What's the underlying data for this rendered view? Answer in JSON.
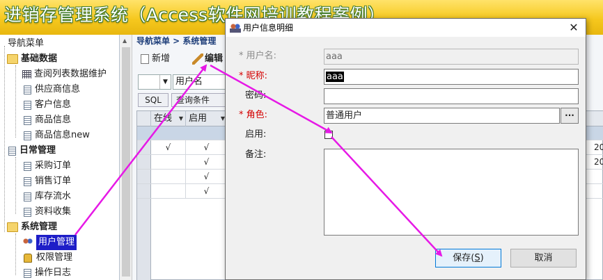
{
  "app": {
    "title": "进销存管理系统（Access软件网培训教程案例）"
  },
  "sidebar": {
    "root": "导航菜单",
    "groups": [
      {
        "label": "基础数据",
        "items": [
          "查阅列表数据维护",
          "供应商信息",
          "客户信息",
          "商品信息",
          "商品信息new"
        ]
      },
      {
        "label": "日常管理",
        "items": [
          "采购订单",
          "销售订单",
          "库存流水",
          "资料收集"
        ]
      },
      {
        "label": "系统管理",
        "items": [
          "用户管理",
          "权限管理",
          "操作日志"
        ]
      }
    ]
  },
  "main": {
    "breadcrumb": "导航菜单 > 系统管理",
    "toolbar": {
      "new_label": "新增",
      "edit_label": "编辑"
    },
    "filter": {
      "field_value": "用户名",
      "sql_label": "SQL",
      "query_label": "查询条件"
    },
    "grid": {
      "columns": [
        "在线",
        "启用"
      ],
      "rows": [
        {
          "online": "√",
          "enabled": "√",
          "extra": "20"
        },
        {
          "online": "",
          "enabled": "√",
          "extra": "20"
        },
        {
          "online": "",
          "enabled": "√",
          "extra": ""
        },
        {
          "online": "",
          "enabled": "√",
          "extra": ""
        }
      ]
    }
  },
  "dialog": {
    "title": "用户信息明细",
    "close": "✕",
    "fields": {
      "username_label": "* 用户名:",
      "username_value": "aaa",
      "nickname_label": "* 昵称:",
      "nickname_value": "aaa",
      "password_label": "密码:",
      "password_value": "",
      "role_label": "* 角色:",
      "role_value": "普通用户",
      "role_button": "...",
      "enabled_label": "启用:",
      "enabled_checked": false,
      "note_label": "备注:",
      "note_value": ""
    },
    "buttons": {
      "save": "保存(S)",
      "save_text": "保存(",
      "save_key": "S",
      "save_tail": ")",
      "cancel": "取消"
    }
  },
  "annotation": {
    "arrow_color": "#e619e6"
  }
}
